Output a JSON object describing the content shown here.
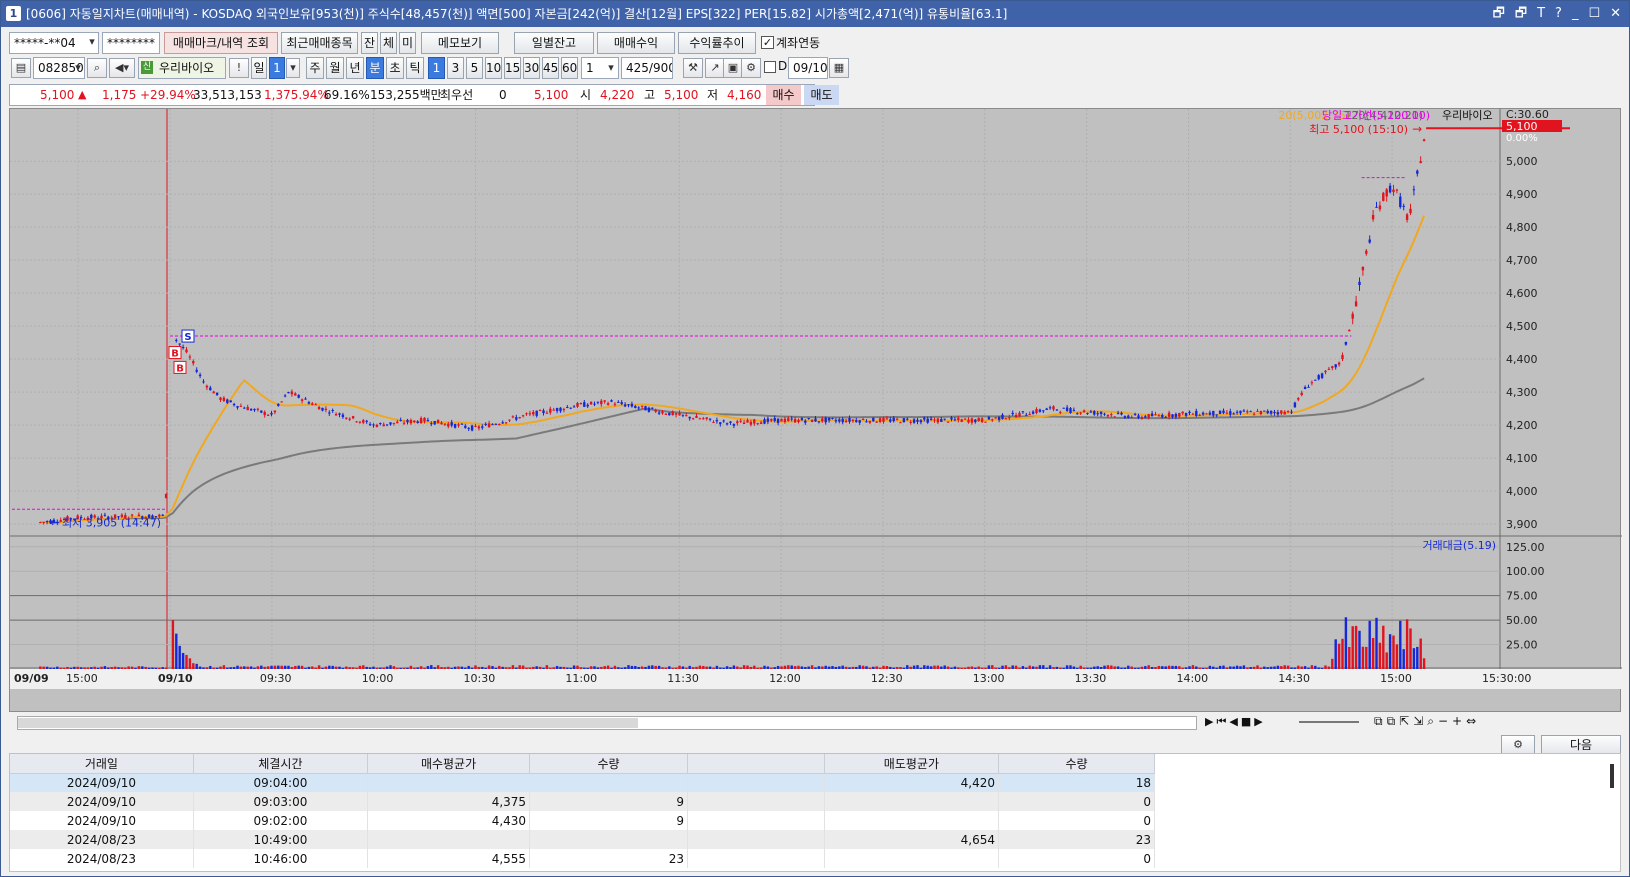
{
  "window": {
    "number": "1",
    "title": "[0606] 자동일지차트(매매내역) - KOSDAQ 외국인보유[953(천)] 주식수[48,457(천)] 액면[500] 자본금[242(억)] 결산[12월] EPS[322] PER[15.82] 시가총액[2,471(억)] 유통비율[63.1]",
    "buttons": [
      "🗗",
      "🗗",
      "T",
      "?",
      "_",
      "☐",
      "✕"
    ]
  },
  "toolbar1": {
    "account": "*****-**04",
    "password": "********",
    "query_button": "매매마크/내역 조회",
    "recent_button": "최근매매종목",
    "btn_jan": "잔",
    "btn_che": "체",
    "btn_mi": "미",
    "memo_button": "메모보기",
    "daily_balance_button": "일별잔고",
    "trade_profit_button": "매매수익",
    "profit_trend_button": "수익률추이",
    "account_link_label": "계좌연동",
    "account_link_checked": true
  },
  "toolbar2": {
    "code": "082850",
    "stock_name": "우리바이오",
    "period_buttons": [
      "일",
      "1",
      "주",
      "월",
      "년",
      "분",
      "초",
      "틱"
    ],
    "interval_buttons": [
      "1",
      "3",
      "5",
      "10",
      "15",
      "30",
      "45",
      "60"
    ],
    "selected_period": "분",
    "selected_interval": "1",
    "count_value": "1",
    "range": "425",
    "range_total": "/900",
    "d_label": "D",
    "date": "09/10"
  },
  "quote": {
    "price": "5,100",
    "change": "1,175",
    "change_pct": "+29.94%",
    "volume": "33,513,153",
    "volume_pct": "1,375.94%",
    "ratio": "69.16%",
    "amount": "153,255백만",
    "label_choi": "최우선",
    "choi_value": "0",
    "best_price": "5,100",
    "open_label": "시",
    "open": "4,220",
    "high_label": "고",
    "high": "5,100",
    "low_label": "저",
    "low": "4,160",
    "buy_button": "매수",
    "sell_button": "매도"
  },
  "chart_data": {
    "type": "line",
    "title": "",
    "legend": {
      "ma20": "20(5,002.75)",
      "ma120": "120(4,422.21)",
      "upper_limit": "당일고가선(5,100.00)",
      "name": "우리바이오",
      "c_label": "C:30.60"
    },
    "price_axis": [
      "5,000",
      "4,900",
      "4,800",
      "4,700",
      "4,600",
      "4,500",
      "4,400",
      "4,300",
      "4,200",
      "4,100",
      "4,000",
      "3,900"
    ],
    "price_tag": "5,100",
    "pct_tag": "0.00%",
    "high_annotation": "최고 5,100 (15:10)",
    "low_annotation": "최저 3,905 (14:47)",
    "volume_legend": "거래대금(5.19)",
    "volume_axis": [
      "125.00",
      "100.00",
      "75.00",
      "50.00",
      "25.00"
    ],
    "time_axis": [
      "09/09",
      "15:00",
      "09/10",
      "09:30",
      "10:00",
      "10:30",
      "11:00",
      "11:30",
      "12:00",
      "12:30",
      "13:00",
      "13:30",
      "14:00",
      "14:30",
      "15:00",
      "15:30:00"
    ],
    "markers": [
      "S",
      "B",
      "B"
    ],
    "ylim": [
      3870,
      5140
    ],
    "price_series": [
      {
        "t": "09/09 14:47",
        "v": 3905
      },
      {
        "t": "09/09 15:00",
        "v": 3920
      },
      {
        "t": "09/09 15:30",
        "v": 3925
      },
      {
        "t": "09/10 09:00",
        "v": 4200
      },
      {
        "t": "09:01",
        "v": 4470
      },
      {
        "t": "09:05",
        "v": 4420
      },
      {
        "t": "09:10",
        "v": 4330
      },
      {
        "t": "09:15",
        "v": 4280
      },
      {
        "t": "09:20",
        "v": 4260
      },
      {
        "t": "09:30",
        "v": 4230
      },
      {
        "t": "09:35",
        "v": 4300
      },
      {
        "t": "09:45",
        "v": 4250
      },
      {
        "t": "10:00",
        "v": 4200
      },
      {
        "t": "10:15",
        "v": 4215
      },
      {
        "t": "10:30",
        "v": 4190
      },
      {
        "t": "10:45",
        "v": 4230
      },
      {
        "t": "11:00",
        "v": 4260
      },
      {
        "t": "11:10",
        "v": 4270
      },
      {
        "t": "11:30",
        "v": 4230
      },
      {
        "t": "11:45",
        "v": 4205
      },
      {
        "t": "12:00",
        "v": 4215
      },
      {
        "t": "12:30",
        "v": 4215
      },
      {
        "t": "13:00",
        "v": 4215
      },
      {
        "t": "13:20",
        "v": 4250
      },
      {
        "t": "13:45",
        "v": 4225
      },
      {
        "t": "14:00",
        "v": 4235
      },
      {
        "t": "14:30",
        "v": 4240
      },
      {
        "t": "14:35",
        "v": 4320
      },
      {
        "t": "14:45",
        "v": 4390
      },
      {
        "t": "14:50",
        "v": 4600
      },
      {
        "t": "14:55",
        "v": 4850
      },
      {
        "t": "15:00",
        "v": 4930
      },
      {
        "t": "15:05",
        "v": 4820
      },
      {
        "t": "15:10",
        "v": 5100
      }
    ]
  },
  "grid": {
    "columns": [
      "거래일",
      "체결시간",
      "매수평균가",
      "수량",
      "",
      "매도평균가",
      "수량"
    ],
    "rows": [
      [
        "2024/09/10",
        "09:04:00",
        "",
        "",
        "",
        "4,420",
        "18"
      ],
      [
        "2024/09/10",
        "09:03:00",
        "4,375",
        "9",
        "",
        "",
        "0"
      ],
      [
        "2024/09/10",
        "09:02:00",
        "4,430",
        "9",
        "",
        "",
        "0"
      ],
      [
        "2024/08/23",
        "10:49:00",
        "",
        "",
        "",
        "4,654",
        "23"
      ],
      [
        "2024/08/23",
        "10:46:00",
        "4,555",
        "23",
        "",
        "",
        "0"
      ]
    ],
    "next_button": "다음"
  },
  "colors": {
    "up": "#e0131f",
    "down": "#1328d8",
    "ma20": "#f0a820",
    "ma120": "#7a7a7a",
    "limit": "#e800e8",
    "bg": "#c0c0c0"
  }
}
